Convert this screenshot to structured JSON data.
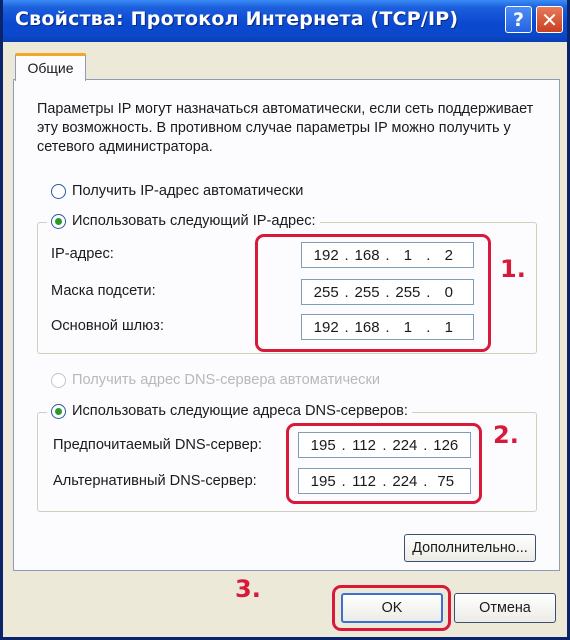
{
  "window": {
    "title": "Свойства: Протокол Интернета (TCP/IP)",
    "help_glyph": "?",
    "close_glyph": "✕"
  },
  "tab": {
    "label": "Общие"
  },
  "description": "Параметры IP могут назначаться автоматически, если сеть поддерживает эту возможность. В противном случае параметры IP можно получить у сетевого администратора.",
  "ip_section": {
    "auto_option": "Получить IP-адрес автоматически",
    "manual_option": "Использовать следующий IP-адрес:",
    "selected": "manual",
    "fields": [
      {
        "label": "IP-адрес:",
        "octets": [
          "192",
          "168",
          "1",
          "2"
        ]
      },
      {
        "label": "Маска подсети:",
        "octets": [
          "255",
          "255",
          "255",
          "0"
        ]
      },
      {
        "label": "Основной шлюз:",
        "octets": [
          "192",
          "168",
          "1",
          "1"
        ]
      }
    ]
  },
  "dns_section": {
    "auto_option": "Получить адрес DNS-сервера автоматически",
    "manual_option": "Использовать следующие адреса DNS-серверов:",
    "selected": "manual",
    "fields": [
      {
        "label": "Предпочитаемый DNS-сервер:",
        "octets": [
          "195",
          "112",
          "224",
          "126"
        ]
      },
      {
        "label": "Альтернативный DNS-сервер:",
        "octets": [
          "195",
          "112",
          "224",
          "75"
        ]
      }
    ]
  },
  "buttons": {
    "advanced": "Дополнительно...",
    "ok": "OK",
    "cancel": "Отмена"
  },
  "annotations": [
    "1.",
    "2.",
    "3."
  ],
  "colors": {
    "highlight": "#d8193a",
    "titlebar": "#0a49d1",
    "radio_dot": "#2b9a2b"
  }
}
